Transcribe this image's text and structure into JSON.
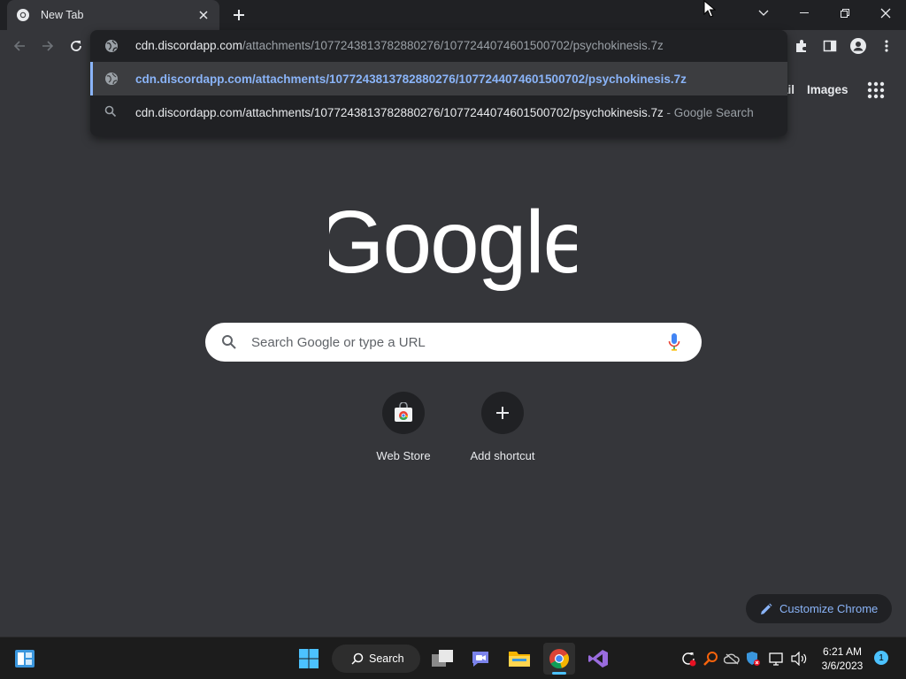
{
  "tab": {
    "title": "New Tab",
    "new_tab_label": "+"
  },
  "omnibox": {
    "host": "cdn.discordapp.com",
    "path": "/attachments/1077243813782880276/1077244074601500702/psychokinesis.7z",
    "suggestions": [
      {
        "text": "cdn.discordapp.com/attachments/1077243813782880276/1077244074601500702/psychokinesis.7z",
        "icon": "globe-icon",
        "selected": true
      },
      {
        "text": "cdn.discordapp.com/attachments/1077243813782880276/1077244074601500702/psychokinesis.7z",
        "suffix": " - Google Search",
        "icon": "search-icon"
      }
    ]
  },
  "ntp": {
    "links": {
      "gmail": "Gmail",
      "images": "Images"
    },
    "logo": "Google",
    "search_placeholder": "Search Google or type a URL",
    "shortcuts": [
      {
        "label": "Web Store",
        "icon": "web-store-icon"
      },
      {
        "label": "Add shortcut",
        "icon": "plus-icon"
      }
    ],
    "customize_label": "Customize Chrome"
  },
  "taskbar": {
    "search_label": "Search",
    "time": "6:21 AM",
    "date": "3/6/2023",
    "notification_count": "1"
  },
  "colors": {
    "accent": "#8ab4f8",
    "background": "#35363a",
    "frame": "#202124"
  }
}
